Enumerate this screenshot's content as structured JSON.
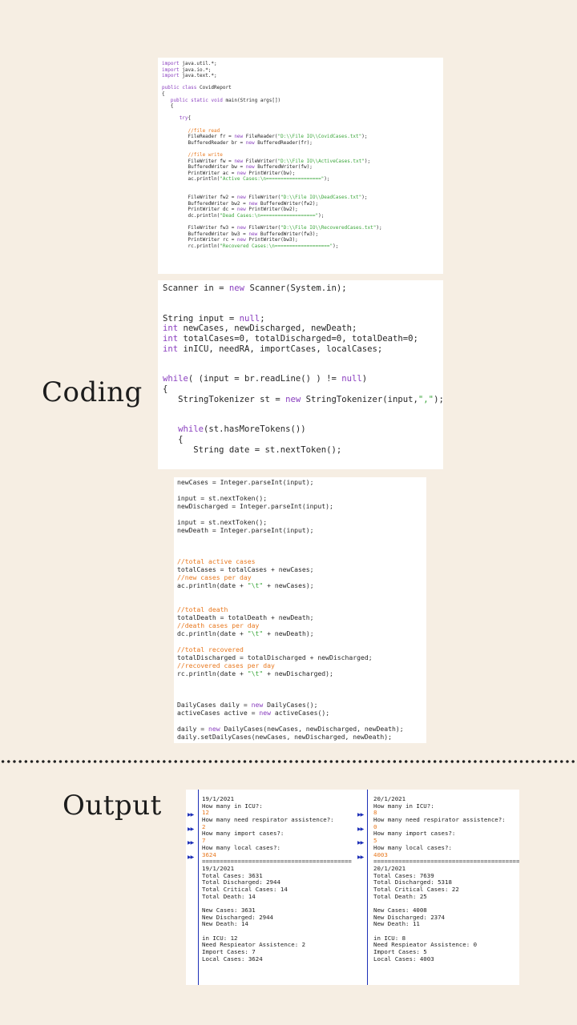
{
  "headings": {
    "coding": "Coding",
    "output": "Output"
  },
  "code_panels": [
    {
      "lines": [
        [
          "import java.util.*;",
          ""
        ],
        [
          "import java.io.*;",
          ""
        ],
        [
          "import java.text.*;",
          ""
        ],
        [
          "",
          ""
        ],
        [
          "public class CovidReport",
          "kw-lead"
        ],
        [
          "{",
          ""
        ],
        [
          "   public static void main(String args[])",
          "kw-lead"
        ],
        [
          "   {",
          ""
        ],
        [
          "",
          ""
        ],
        [
          "      try{",
          "kw-lead"
        ],
        [
          "",
          ""
        ],
        [
          "         //file read",
          "cm"
        ],
        [
          "         FileReader fr = new FileReader(\"D:\\\\File IO\\\\CovidCases.txt\");",
          "str"
        ],
        [
          "         BufferedReader br = new BufferedReader(fr);",
          ""
        ],
        [
          "",
          ""
        ],
        [
          "         //file write",
          "cm"
        ],
        [
          "         FileWriter fw = new FileWriter(\"D:\\\\File IO\\\\ActiveCases.txt\");",
          "str"
        ],
        [
          "         BufferedWriter bw = new BufferedWriter(fw);",
          ""
        ],
        [
          "         PrintWriter ac = new PrintWriter(bw);",
          ""
        ],
        [
          "         ac.println(\"Active Cases:\\n===================\");",
          "str"
        ],
        [
          "",
          ""
        ],
        [
          "",
          ""
        ],
        [
          "         FileWriter fw2 = new FileWriter(\"D:\\\\File IO\\\\DeadCases.txt\");",
          "str"
        ],
        [
          "         BufferedWriter bw2 = new BufferedWriter(fw2);",
          ""
        ],
        [
          "         PrintWriter dc = new PrintWriter(bw2);",
          ""
        ],
        [
          "         dc.println(\"Dead Cases:\\n===================\");",
          "str"
        ],
        [
          "",
          ""
        ],
        [
          "         FileWriter fw3 = new FileWriter(\"D:\\\\File IO\\\\RecoveredCases.txt\");",
          "str"
        ],
        [
          "         BufferedWriter bw3 = new BufferedWriter(fw3);",
          ""
        ],
        [
          "         PrintWriter rc = new PrintWriter(bw3);",
          ""
        ],
        [
          "         rc.println(\"Recovered Cases:\\n===================\");",
          "str"
        ]
      ]
    },
    {
      "lines": [
        [
          "Scanner in = new Scanner(System.in);",
          ""
        ],
        [
          "",
          ""
        ],
        [
          "",
          ""
        ],
        [
          "String input = null;",
          ""
        ],
        [
          "int newCases, newDischarged, newDeath;",
          "kw-lead"
        ],
        [
          "int totalCases=0, totalDischarged=0, totalDeath=0;",
          "kw-lead"
        ],
        [
          "int inICU, needRA, importCases, localCases;",
          "kw-lead"
        ],
        [
          "",
          ""
        ],
        [
          "",
          ""
        ],
        [
          "while( (input = br.readLine() ) != null)",
          "kw-lead"
        ],
        [
          "{",
          ""
        ],
        [
          "   StringTokenizer st = new StringTokenizer(input,\",\");",
          "str"
        ],
        [
          "",
          ""
        ],
        [
          "",
          ""
        ],
        [
          "   while(st.hasMoreTokens())",
          "kw-lead"
        ],
        [
          "   {",
          ""
        ],
        [
          "      String date = st.nextToken();",
          ""
        ],
        [
          "",
          ""
        ],
        [
          "",
          ""
        ],
        [
          "      input = st.nextToken();",
          ""
        ]
      ]
    },
    {
      "lines": [
        [
          "newCases = Integer.parseInt(input);",
          ""
        ],
        [
          "",
          ""
        ],
        [
          "input = st.nextToken();",
          ""
        ],
        [
          "newDischarged = Integer.parseInt(input);",
          ""
        ],
        [
          "",
          ""
        ],
        [
          "input = st.nextToken();",
          ""
        ],
        [
          "newDeath = Integer.parseInt(input);",
          ""
        ],
        [
          "",
          ""
        ],
        [
          "",
          ""
        ],
        [
          "",
          ""
        ],
        [
          "//total active cases",
          "cm"
        ],
        [
          "totalCases = totalCases + newCases;",
          ""
        ],
        [
          "//new cases per day",
          "cm"
        ],
        [
          "ac.println(date + \"\\t\" + newCases);",
          "str"
        ],
        [
          "",
          ""
        ],
        [
          "",
          ""
        ],
        [
          "//total death",
          "cm"
        ],
        [
          "totalDeath = totalDeath + newDeath;",
          ""
        ],
        [
          "//death cases per day",
          "cm"
        ],
        [
          "dc.println(date + \"\\t\" + newDeath);",
          "str"
        ],
        [
          "",
          ""
        ],
        [
          "//total recovered",
          "cm"
        ],
        [
          "totalDischarged = totalDischarged + newDischarged;",
          ""
        ],
        [
          "//recovered cases per day",
          "cm"
        ],
        [
          "rc.println(date + \"\\t\" + newDischarged);",
          "str"
        ],
        [
          "",
          ""
        ],
        [
          "",
          ""
        ],
        [
          "",
          ""
        ],
        [
          "DailyCases daily = new DailyCases();",
          ""
        ],
        [
          "activeCases active = new activeCases();",
          ""
        ],
        [
          "",
          ""
        ],
        [
          "daily = new DailyCases(newCases, newDischarged, newDeath);",
          ""
        ],
        [
          "daily.setDailyCases(newCases, newDischarged, newDeath);",
          ""
        ]
      ]
    }
  ],
  "console": {
    "marker_icon": "double-arrow-icon",
    "accent": "#1d2fb7",
    "input_color": "#e8781e",
    "left": [
      [
        "19/1/2021",
        "",
        false
      ],
      [
        "How many in ICU?:",
        "",
        false
      ],
      [
        "12",
        "input",
        true
      ],
      [
        "How many need respirator assistence?:",
        "",
        false
      ],
      [
        "2",
        "input",
        true
      ],
      [
        "How many import cases?:",
        "",
        false
      ],
      [
        "7",
        "input",
        true
      ],
      [
        "How many local cases?:",
        "",
        false
      ],
      [
        "3624",
        "input",
        true
      ],
      [
        "==========================================",
        "",
        false
      ],
      [
        "19/1/2021",
        "",
        false
      ],
      [
        "Total Cases: 3631",
        "",
        false
      ],
      [
        "Total Discharged: 2944",
        "",
        false
      ],
      [
        "Total Critical Cases: 14",
        "",
        false
      ],
      [
        "Total Death: 14",
        "",
        false
      ],
      [
        "",
        "",
        false
      ],
      [
        "New Cases: 3631",
        "",
        false
      ],
      [
        "New Discharged: 2944",
        "",
        false
      ],
      [
        "New Death: 14",
        "",
        false
      ],
      [
        "",
        "",
        false
      ],
      [
        "in ICU: 12",
        "",
        false
      ],
      [
        "Need Respieator Assistence: 2",
        "",
        false
      ],
      [
        "Import Cases: 7",
        "",
        false
      ],
      [
        "Local Cases: 3624",
        "",
        false
      ]
    ],
    "right": [
      [
        "20/1/2021",
        "",
        false
      ],
      [
        "How many in ICU?:",
        "",
        false
      ],
      [
        "8",
        "input",
        true
      ],
      [
        "How many need respirator assistence?:",
        "",
        false
      ],
      [
        "0",
        "input",
        true
      ],
      [
        "How many import cases?:",
        "",
        false
      ],
      [
        "5",
        "input",
        true
      ],
      [
        "How many local cases?:",
        "",
        false
      ],
      [
        "4003",
        "input",
        true
      ],
      [
        "==========================================",
        "",
        false
      ],
      [
        "20/1/2021",
        "",
        false
      ],
      [
        "Total Cases: 7639",
        "",
        false
      ],
      [
        "Total Discharged: 5318",
        "",
        false
      ],
      [
        "Total Critical Cases: 22",
        "",
        false
      ],
      [
        "Total Death: 25",
        "",
        false
      ],
      [
        "",
        "",
        false
      ],
      [
        "New Cases: 4008",
        "",
        false
      ],
      [
        "New Discharged: 2374",
        "",
        false
      ],
      [
        "New Death: 11",
        "",
        false
      ],
      [
        "",
        "",
        false
      ],
      [
        "in ICU: 8",
        "",
        false
      ],
      [
        "Need Respieator Assistence: 0",
        "",
        false
      ],
      [
        "Import Cases: 5",
        "",
        false
      ],
      [
        "Local Cases: 4003",
        "",
        false
      ]
    ]
  }
}
